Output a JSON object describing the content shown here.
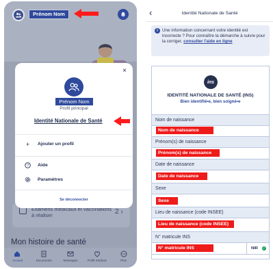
{
  "left": {
    "profile_name": "Prénom Nom",
    "card": {
      "line1": "Examens médicaux et vaccinations",
      "line2": "à réaliser",
      "count": "2",
      "chevron": "›"
    },
    "history_title": "Mon histoire de santé",
    "tabs": [
      {
        "label": "Accueil",
        "icon": "home-icon"
      },
      {
        "label": "Documents",
        "icon": "document-icon"
      },
      {
        "label": "Messages",
        "icon": "mail-icon"
      },
      {
        "label": "Profil médical",
        "icon": "medical-profile-icon"
      },
      {
        "label": "Plus",
        "icon": "more-icon"
      }
    ],
    "modal": {
      "close": "×",
      "name": "Prénom Nom",
      "profile_type": "Profil principal",
      "ins_link": "Identité Nationale de Santé",
      "add_profile": "Ajouter un profil",
      "help": "Aide",
      "settings": "Paramètres",
      "logout": "Se déconnecter"
    }
  },
  "right": {
    "back": "‹",
    "title": "Identité Nationale de Santé",
    "info": {
      "text": "Une information concernant votre identité est incorrecte ? Pour connaître la démarche à suivre pour la corriger,",
      "link": "consulter l'aide en ligne"
    },
    "logo_text": "ins",
    "card_title": "IDENTITÉ NATIONALE DE SANTÉ (INS)",
    "card_subtitle": "Bien identifié•e, bien soigné•e",
    "fields": [
      {
        "label": "Nom de naissance",
        "value": "Nom de naissance"
      },
      {
        "label": "Prénom(s) de naissance",
        "value": "Prénom(s) de naissance"
      },
      {
        "label": "Date de naissance",
        "value": "Date de naissance"
      },
      {
        "label": "Sexe",
        "value": "Sexe"
      },
      {
        "label": "Lieu de naissance (code INSEE)",
        "value": "Lieu de naissance (code INSEE)"
      },
      {
        "label": "N° matricule INS",
        "value": "N° matricule INS"
      }
    ],
    "nir_label": "NIR",
    "nir_check": "✓"
  },
  "colors": {
    "primary": "#2f4a9c",
    "redact": "#ee1b1b",
    "arrow": "#ff1b1b",
    "overlay": "#9ba2b3"
  }
}
